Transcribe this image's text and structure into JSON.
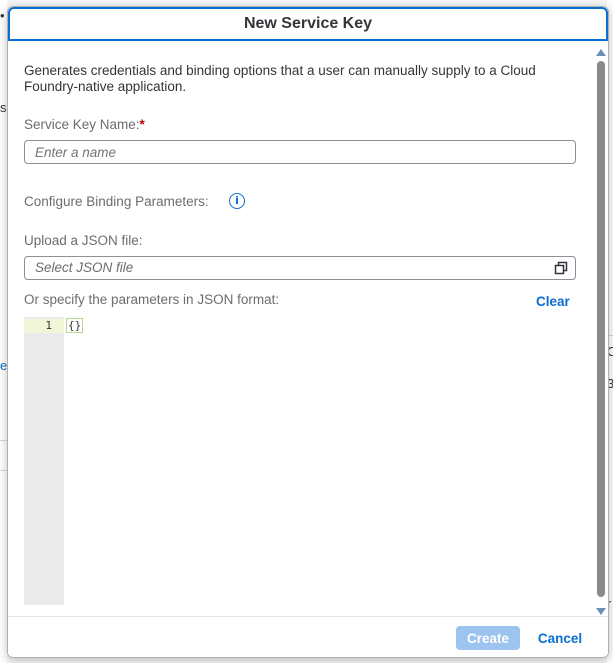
{
  "dialog": {
    "title": "New Service Key",
    "description": "Generates credentials and binding options that a user can manually supply to a Cloud Foundry-native application.",
    "service_key_name": {
      "label": "Service Key Name:",
      "required_marker": "*",
      "value": "",
      "placeholder": "Enter a name"
    },
    "binding_parameters": {
      "label": "Configure Binding Parameters:",
      "info_icon": "info-icon"
    },
    "upload": {
      "label": "Upload a JSON file:",
      "placeholder": "Select JSON file",
      "browse_icon": "window-restore-icon"
    },
    "json_editor": {
      "label": "Or specify the parameters in JSON format:",
      "clear_label": "Clear",
      "lines": [
        {
          "number": "1",
          "content": "{}"
        }
      ]
    },
    "footer": {
      "create_label": "Create",
      "cancel_label": "Cancel"
    }
  },
  "background": {
    "fragments": [
      "•",
      "s",
      "er",
      "C",
      "3",
      "r"
    ]
  },
  "colors": {
    "accent": "#0a6ed1",
    "required": "#bb0000",
    "create_disabled": "#9dc4ef"
  }
}
